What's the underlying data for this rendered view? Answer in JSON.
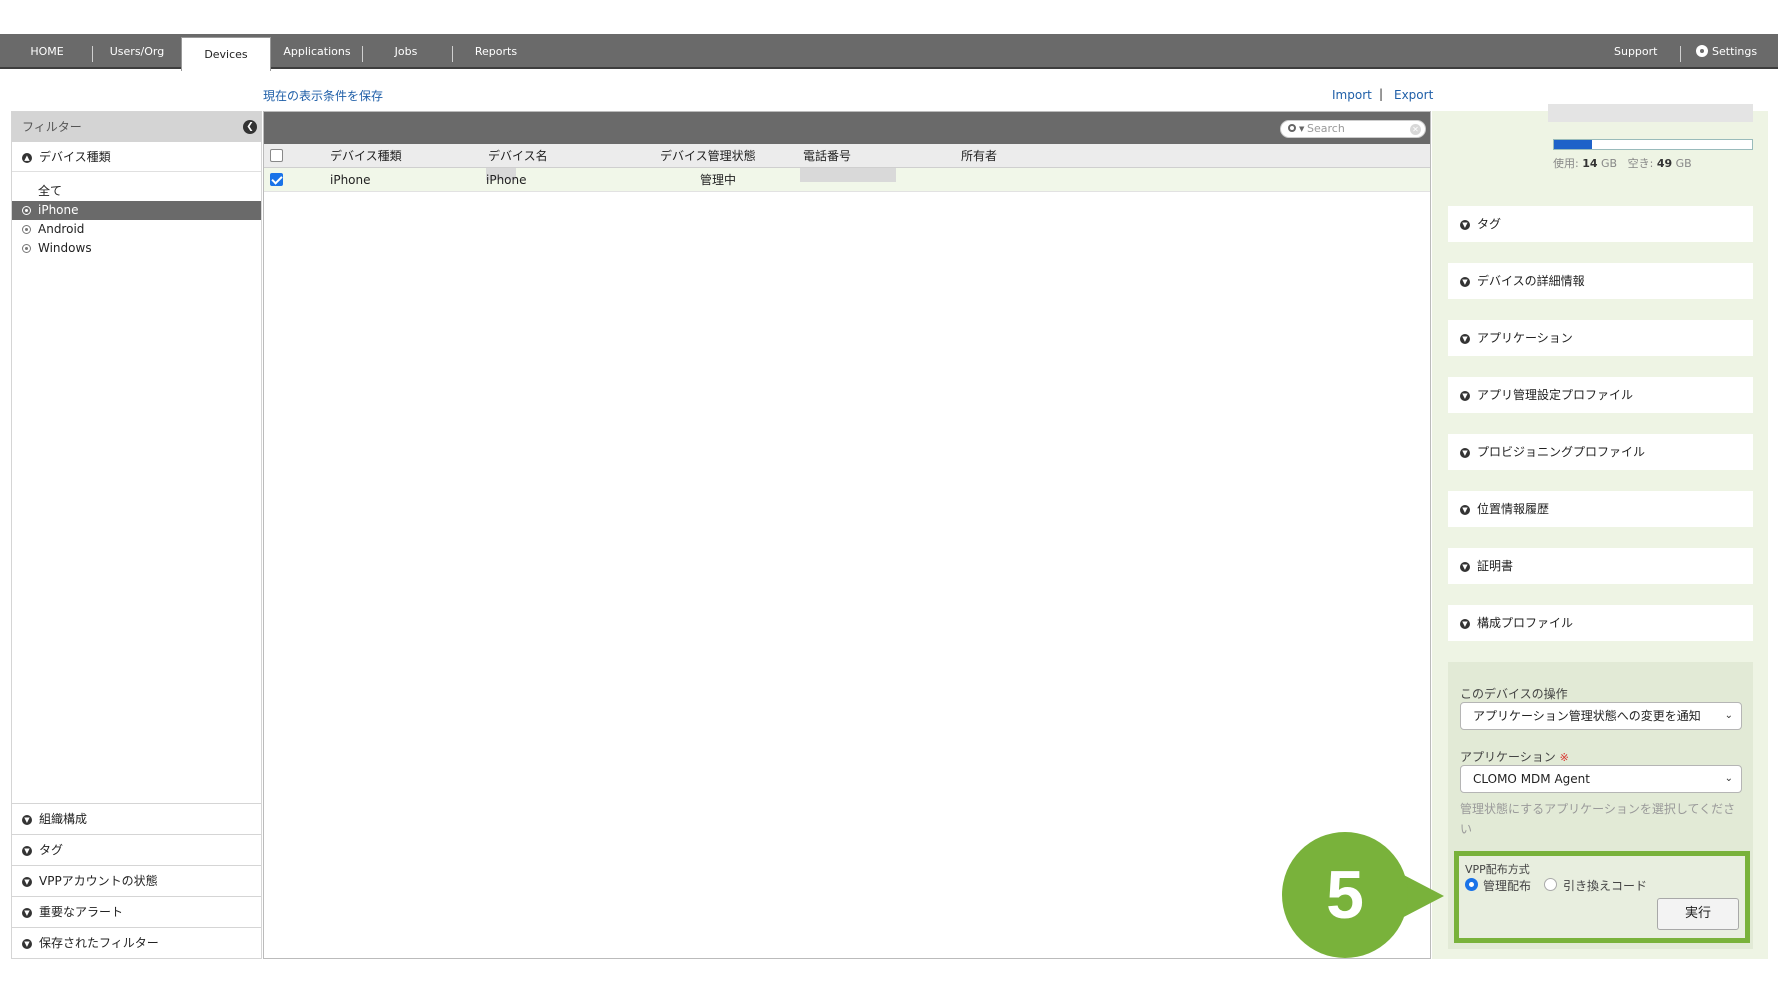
{
  "nav": {
    "tabs": [
      "HOME",
      "Users/Org",
      "Devices",
      "Applications",
      "Jobs",
      "Reports"
    ],
    "active_tab": "Devices",
    "support": "Support",
    "settings": "Settings"
  },
  "links": {
    "save_view": "現在の表示条件を保存",
    "import": "Import",
    "separator": "|",
    "export": "Export"
  },
  "filter": {
    "title": "フィルター",
    "device_type_header": "デバイス種類",
    "device_types": [
      "全て",
      "iPhone",
      "Android",
      "Windows"
    ],
    "selected": "iPhone",
    "bottom_sections": [
      "組織構成",
      "タグ",
      "VPPアカウントの状態",
      "重要なアラート",
      "保存されたフィルター"
    ]
  },
  "table": {
    "search_placeholder": "Search",
    "columns": [
      "デバイス種類",
      "デバイス名",
      "デバイス管理状態",
      "電話番号",
      "所有者"
    ],
    "rows": [
      {
        "checked": true,
        "type": "iPhone",
        "name_suffix": "iPhone",
        "status": "管理中",
        "phone": "",
        "owner": ""
      }
    ]
  },
  "device_panel": {
    "storage": {
      "used_label": "使用:",
      "used_value": "14",
      "used_unit": "GB",
      "free_label": "空き:",
      "free_value": "49",
      "free_unit": "GB",
      "used_fraction": 0.19
    },
    "sections": [
      "タグ",
      "デバイスの詳細情報",
      "アプリケーション",
      "アプリ管理設定プロファイル",
      "プロビジョニングプロファイル",
      "位置情報履歴",
      "証明書",
      "構成プロファイル"
    ],
    "operations": {
      "title": "このデバイスの操作",
      "action_value": "アプリケーション管理状態への変更を通知",
      "app_label": "アプリケーション",
      "required_mark": "※",
      "app_value": "CLOMO MDM Agent",
      "hint": "管理状態にするアプリケーションを選択してください",
      "vpp_label": "VPP配布方式",
      "vpp_options": [
        "管理配布",
        "引き換えコード"
      ],
      "vpp_selected": "管理配布",
      "execute": "実行"
    }
  },
  "step_badge": "5",
  "colors": {
    "accent_green": "#79b23b",
    "nav_gray": "#6a6a6a",
    "link_blue": "#1f5fa8",
    "storage_blue": "#1e62c9"
  }
}
